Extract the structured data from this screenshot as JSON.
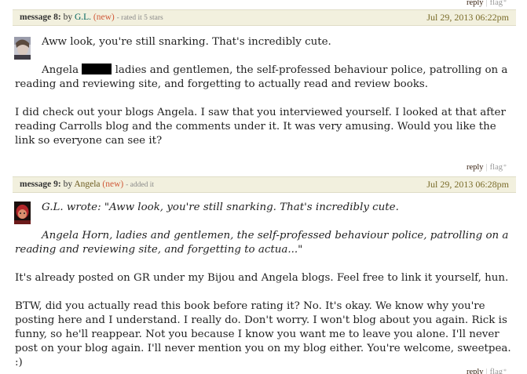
{
  "actions": {
    "reply_label": "reply",
    "separator": "|",
    "flag_label": "flag",
    "flag_caret": "*"
  },
  "messages": [
    {
      "number_label": "message 8:",
      "by_label": "by",
      "author": "G.L.",
      "new_label": "(new)",
      "sub_note": "- rated it 5 stars",
      "date": "Jul 29, 2013 06:22pm",
      "paragraphs": {
        "p1": "Aww look, you're still snarking. That's incredibly cute.",
        "p2_pre": "Angela",
        "p2_post": "ladies and gentlemen, the self-professed behaviour police, patrolling on a reading and reviewing site, and forgetting to actually read and review books.",
        "p3": "I did check out your blogs Angela. I saw that you interviewed yourself. I looked at that after reading Carrolls blog and the comments under it. It was very amusing. Would you like the link so everyone can see it?"
      }
    },
    {
      "number_label": "message 9:",
      "by_label": "by",
      "author": "Angela",
      "new_label": "(new)",
      "sub_note": "- added it",
      "date": "Jul 29, 2013 06:28pm",
      "paragraphs": {
        "quote1": "G.L. wrote: \"Aww look, you're still snarking. That's incredibly cute.",
        "quote2": "Angela Horn, ladies and gentlemen, the self-professed behaviour police, patrolling on a reading and reviewing site, and forgetting to actua...\"",
        "p1": "It's already posted on GR under my Bijou and Angela blogs. Feel free to link it yourself, hun.",
        "p2": "BTW, did you actually read this book before rating it? No. It's okay. We know why you're posting here and I understand. I really do. Don't worry. I won't blog about you again. Rick is funny, so he'll reappear. Not you because I know you want me to leave you alone. I'll never post on your blog again. I'll never mention you on my blog either. You're welcome, sweetpea. :)"
      }
    }
  ],
  "colors": {
    "header_bg": "#f2f0de",
    "author_link": "#00635d",
    "new_tag": "#d05a3a",
    "date": "#7a6c2a"
  }
}
